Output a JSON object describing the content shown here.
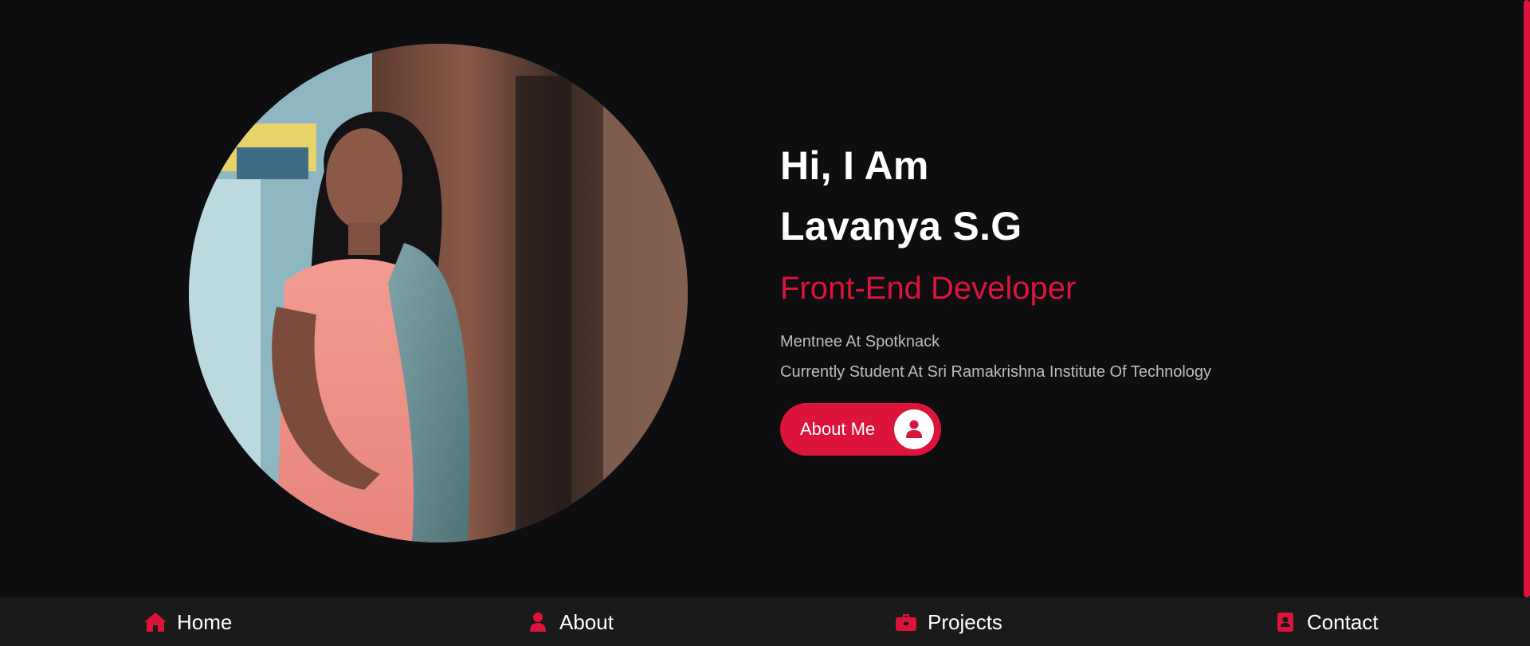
{
  "hero": {
    "greeting_line1": "Hi, I Am",
    "greeting_line2": "Lavanya S.G",
    "role": "Front-End Developer",
    "info_lines": [
      "Mentnee At Spotknack",
      "Currently Student At Sri Ramakrishna Institute Of Technology"
    ],
    "about_button_label": "About Me",
    "about_button_icon": "user-icon"
  },
  "nav": {
    "items": [
      {
        "label": "Home",
        "icon": "home-icon"
      },
      {
        "label": "About",
        "icon": "user-icon"
      },
      {
        "label": "Projects",
        "icon": "briefcase-icon"
      },
      {
        "label": "Contact",
        "icon": "address-book-icon"
      }
    ]
  },
  "colors": {
    "background": "#0e0d0f",
    "accent": "#dc143c",
    "nav_background": "#1a1a1a",
    "muted_text": "#bdbdbd"
  }
}
